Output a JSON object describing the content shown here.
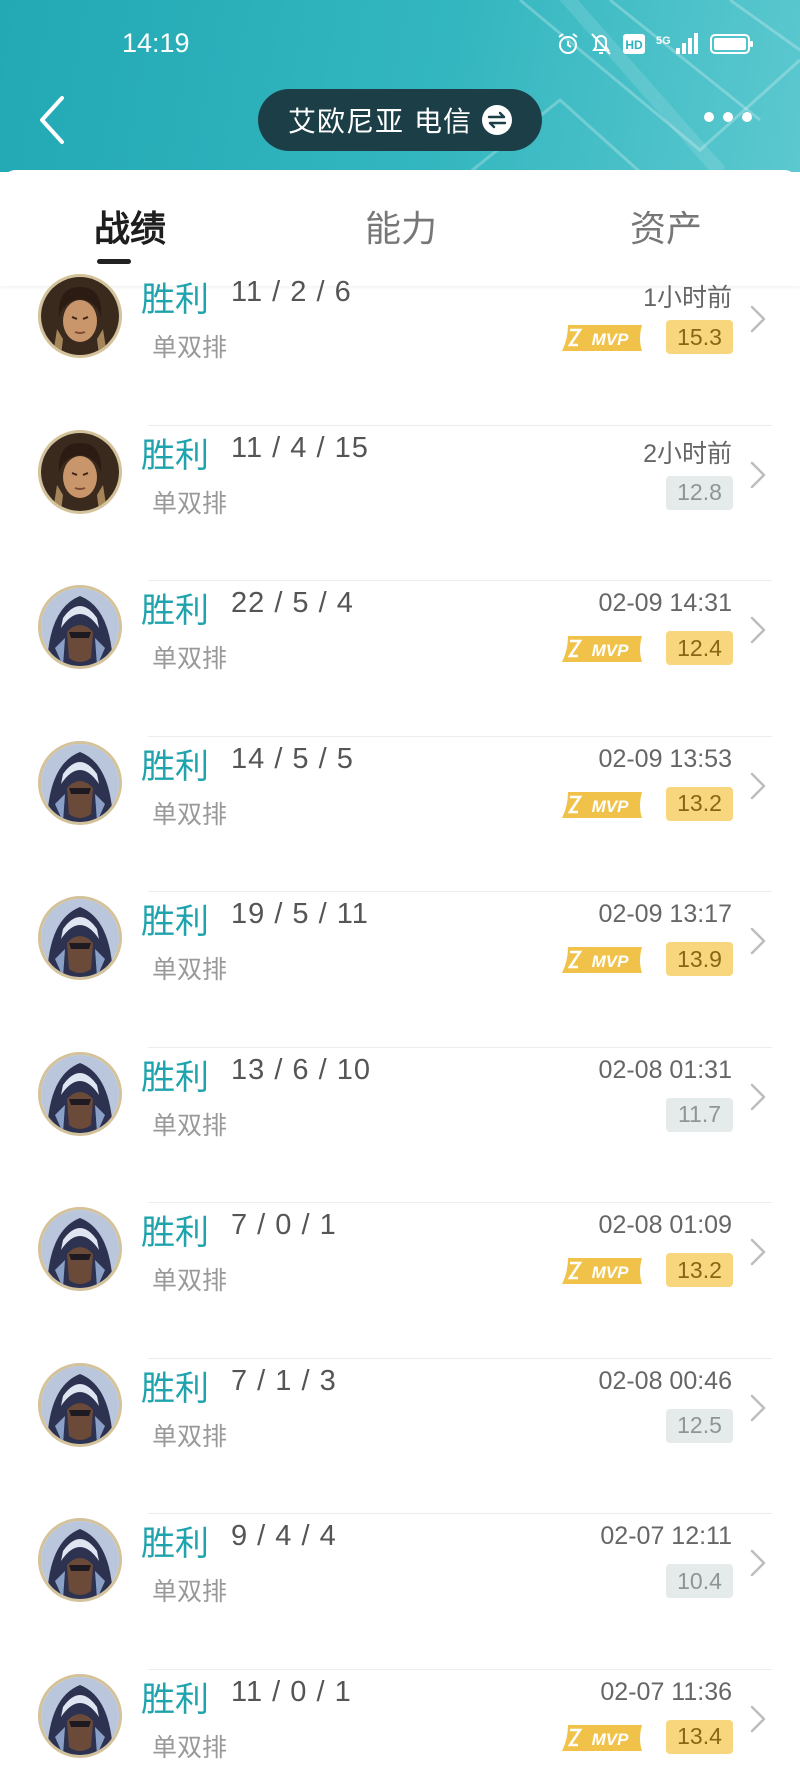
{
  "status_bar": {
    "time": "14:19",
    "icons": [
      "alarm-icon",
      "bell-mute-icon",
      "hd-icon",
      "signal-5g-icon",
      "battery-icon"
    ]
  },
  "header": {
    "server_name": "艾欧尼亚 电信",
    "icons": [
      "back-icon",
      "swap-icon",
      "more-icon"
    ]
  },
  "tabs": [
    {
      "label": "战绩",
      "active": true
    },
    {
      "label": "能力",
      "active": false
    },
    {
      "label": "资产",
      "active": false
    }
  ],
  "colors": {
    "header_bg": "#2eb1bb",
    "win_text": "#1fa3ad",
    "mvp_gold": "#f7d67e",
    "score_gray": "#e5ebea"
  },
  "matches": [
    {
      "result": "胜利",
      "kda": "11 / 2 / 6",
      "mode": "单双排",
      "time": "1小时前",
      "mvp": true,
      "score": "15.3",
      "avatar": "champion-a"
    },
    {
      "result": "胜利",
      "kda": "11 / 4 / 15",
      "mode": "单双排",
      "time": "2小时前",
      "mvp": false,
      "score": "12.8",
      "avatar": "champion-a"
    },
    {
      "result": "胜利",
      "kda": "22 / 5 / 4",
      "mode": "单双排",
      "time": "02-09 14:31",
      "mvp": true,
      "score": "12.4",
      "avatar": "champion-b"
    },
    {
      "result": "胜利",
      "kda": "14 / 5 / 5",
      "mode": "单双排",
      "time": "02-09 13:53",
      "mvp": true,
      "score": "13.2",
      "avatar": "champion-b"
    },
    {
      "result": "胜利",
      "kda": "19 / 5 / 11",
      "mode": "单双排",
      "time": "02-09 13:17",
      "mvp": true,
      "score": "13.9",
      "avatar": "champion-b"
    },
    {
      "result": "胜利",
      "kda": "13 / 6 / 10",
      "mode": "单双排",
      "time": "02-08 01:31",
      "mvp": false,
      "score": "11.7",
      "avatar": "champion-b"
    },
    {
      "result": "胜利",
      "kda": "7 / 0 / 1",
      "mode": "单双排",
      "time": "02-08 01:09",
      "mvp": true,
      "score": "13.2",
      "avatar": "champion-b"
    },
    {
      "result": "胜利",
      "kda": "7 / 1 / 3",
      "mode": "单双排",
      "time": "02-08 00:46",
      "mvp": false,
      "score": "12.5",
      "avatar": "champion-b"
    },
    {
      "result": "胜利",
      "kda": "9 / 4 / 4",
      "mode": "单双排",
      "time": "02-07 12:11",
      "mvp": false,
      "score": "10.4",
      "avatar": "champion-b"
    },
    {
      "result": "胜利",
      "kda": "11 / 0 / 1",
      "mode": "单双排",
      "time": "02-07 11:36",
      "mvp": true,
      "score": "13.4",
      "avatar": "champion-b"
    }
  ]
}
